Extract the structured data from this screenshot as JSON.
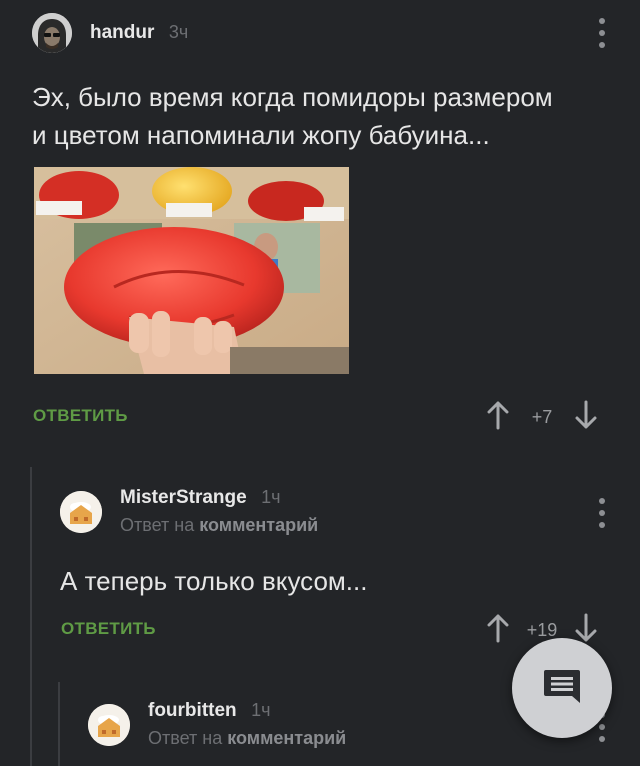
{
  "comments": [
    {
      "username": "handur",
      "time": "3ч",
      "text_line1": "Эх, было время когда помидоры размером",
      "text_line2": "и цветом напоминали жопу бабуина...",
      "reply_label": "ОТВЕТИТЬ",
      "rating": "+7"
    },
    {
      "username": "MisterStrange",
      "time": "1ч",
      "reply_prefix": "Ответ на",
      "reply_target": "комментарий",
      "text": "А теперь только вкусом...",
      "reply_label": "ОТВЕТИТЬ",
      "rating": "+19"
    },
    {
      "username": "fourbitten",
      "time": "1ч",
      "reply_prefix": "Ответ на",
      "reply_target": "комментарий"
    }
  ],
  "icons": {
    "upvote": "arrow-up-icon",
    "downvote": "arrow-down-icon",
    "more": "more-vertical-icon",
    "fab": "comment-icon"
  },
  "colors": {
    "background": "#232528",
    "reply_green": "#5f9b45",
    "muted": "#6d6f73",
    "fab": "#cfd0d3"
  }
}
